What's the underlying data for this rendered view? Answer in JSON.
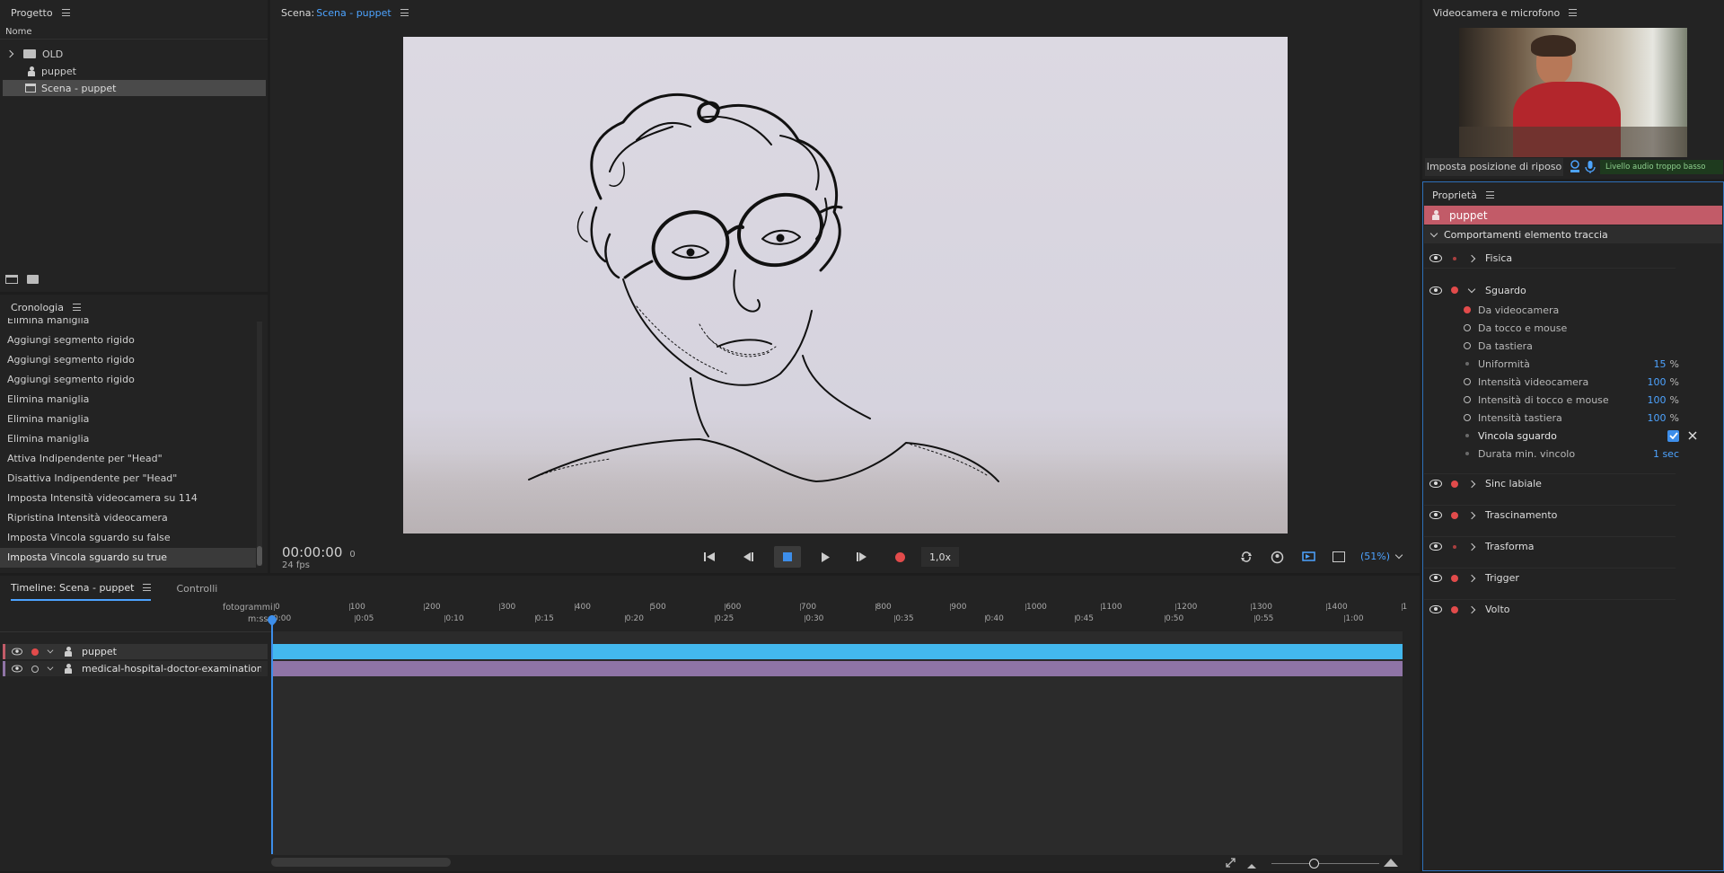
{
  "project": {
    "title": "Progetto",
    "column_header": "Nome",
    "items": [
      {
        "label": "OLD",
        "icon": "folder-icon"
      },
      {
        "label": "puppet",
        "icon": "puppet-icon"
      },
      {
        "label": "Scena - puppet",
        "icon": "scene-icon"
      }
    ]
  },
  "scene": {
    "prefix": "Scena:",
    "name": "Scena - puppet",
    "timecode": "00:00:00",
    "frame": "0",
    "fps": "24 fps",
    "speed": "1,0x",
    "zoom": "(51%)"
  },
  "camera": {
    "title": "Videocamera e microfono",
    "rest_button": "Imposta posizione di riposo",
    "audio_status": "Livello audio troppo basso"
  },
  "history": {
    "title": "Cronologia",
    "items": [
      "Elimina maniglia",
      "Aggiungi segmento rigido",
      "Aggiungi segmento rigido",
      "Aggiungi segmento rigido",
      "Elimina maniglia",
      "Elimina maniglia",
      "Elimina maniglia",
      "Attiva Indipendente per \"Head\"",
      "Disattiva Indipendente per \"Head\"",
      "Imposta Intensità videocamera su 114",
      "Ripristina Intensità videocamera",
      "Imposta Vincola sguardo su false",
      "Imposta Vincola sguardo su true"
    ]
  },
  "properties": {
    "title": "Proprietà",
    "puppet_name": "puppet",
    "section": "Comportamenti elemento traccia",
    "behaviors": [
      "Fisica",
      "Sguardo",
      "Sinc labiale",
      "Trascinamento",
      "Trasforma",
      "Trigger",
      "Volto"
    ],
    "sguardo": {
      "inputs": [
        "Da videocamera",
        "Da tocco e mouse",
        "Da tastiera"
      ],
      "uniformita_label": "Uniformità",
      "uniformita_value": "15",
      "uniformita_unit": "%",
      "intensita_cam_label": "Intensità videocamera",
      "intensita_cam_value": "100",
      "intensita_cam_unit": "%",
      "intensita_mouse_label": "Intensità di tocco e mouse",
      "intensita_mouse_value": "100",
      "intensita_mouse_unit": "%",
      "intensita_tast_label": "Intensità tastiera",
      "intensita_tast_value": "100",
      "intensita_tast_unit": "%",
      "vincola_label": "Vincola sguardo",
      "durata_label": "Durata min. vincolo",
      "durata_value": "1 sec"
    }
  },
  "timeline": {
    "tab1": "Timeline: Scena - puppet",
    "tab2": "Controlli",
    "frames_label": "fotogrammi",
    "time_label": "m:ss",
    "frame_ticks": [
      "0",
      "100",
      "200",
      "300",
      "400",
      "500",
      "600",
      "700",
      "800",
      "900",
      "1000",
      "1100",
      "1200",
      "1300",
      "1400",
      "1"
    ],
    "time_ticks": [
      "0:00",
      "0:05",
      "0:10",
      "0:15",
      "0:20",
      "0:25",
      "0:30",
      "0:35",
      "0:40",
      "0:45",
      "0:50",
      "0:55",
      "1:00"
    ],
    "tracks": [
      "puppet",
      "medical-hospital-doctor-examination-r..."
    ]
  },
  "colors": {
    "accent": "#4da3ff",
    "record": "#e24b4b",
    "puppet_header": "#c25b68",
    "track_puppet": "#43b8ee",
    "track_media": "#8f74a6"
  }
}
